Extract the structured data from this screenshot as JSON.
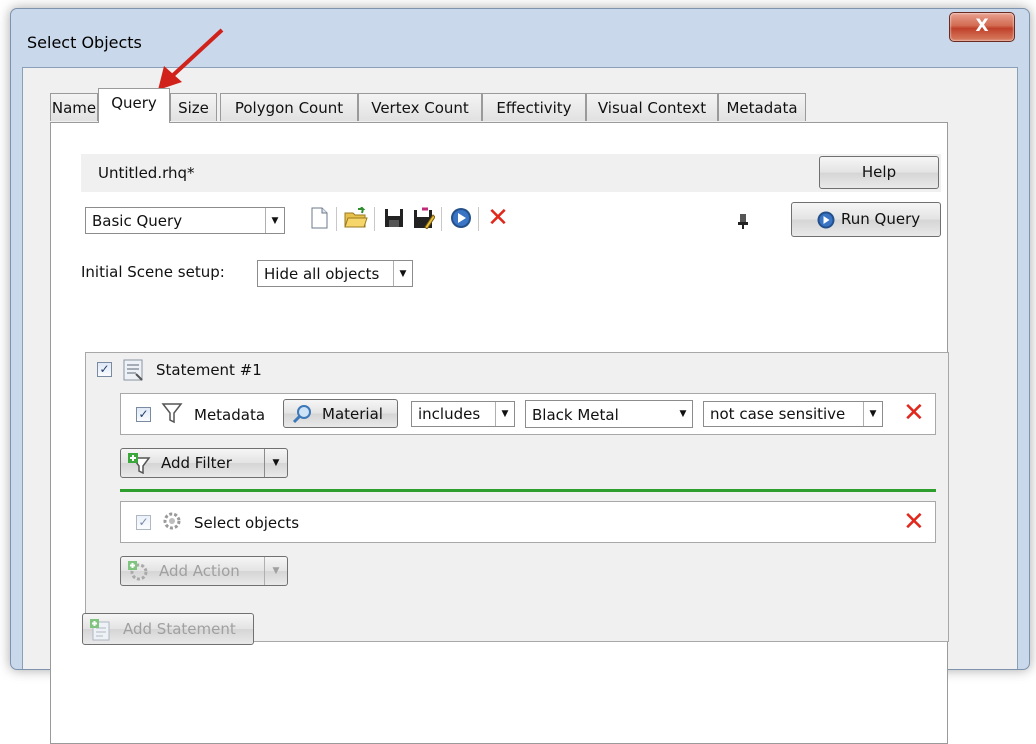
{
  "window": {
    "title": "Select Objects",
    "close_glyph": "X"
  },
  "tabs": [
    {
      "label": "Name"
    },
    {
      "label": "Query"
    },
    {
      "label": "Size"
    },
    {
      "label": "Polygon Count"
    },
    {
      "label": "Vertex Count"
    },
    {
      "label": "Effectivity"
    },
    {
      "label": "Visual Context"
    },
    {
      "label": "Metadata"
    }
  ],
  "active_tab": "Query",
  "file": {
    "name": "Untitled.rhq*",
    "help_label": "Help"
  },
  "toolbar": {
    "query_type": "Basic Query",
    "run_label": "Run Query",
    "icons": [
      "new-document-icon",
      "open-folder-icon",
      "save-icon",
      "save-as-icon",
      "run-icon",
      "delete-icon",
      "pin-icon"
    ]
  },
  "scene": {
    "label": "Initial Scene setup:",
    "value": "Hide all objects"
  },
  "statement": {
    "label": "Statement #1",
    "checked": true,
    "filter": {
      "type_label": "Metadata",
      "field_label": "Material",
      "operator": "includes",
      "value": "Black Metal",
      "case": "not case sensitive"
    },
    "add_filter_label": "Add Filter",
    "action": {
      "label": "Select objects"
    },
    "add_action_label": "Add Action"
  },
  "add_statement_label": "Add Statement",
  "colors": {
    "accent_green": "#2e9e2e",
    "delete_red": "#e0281c",
    "annotation_arrow": "#d0221a"
  }
}
